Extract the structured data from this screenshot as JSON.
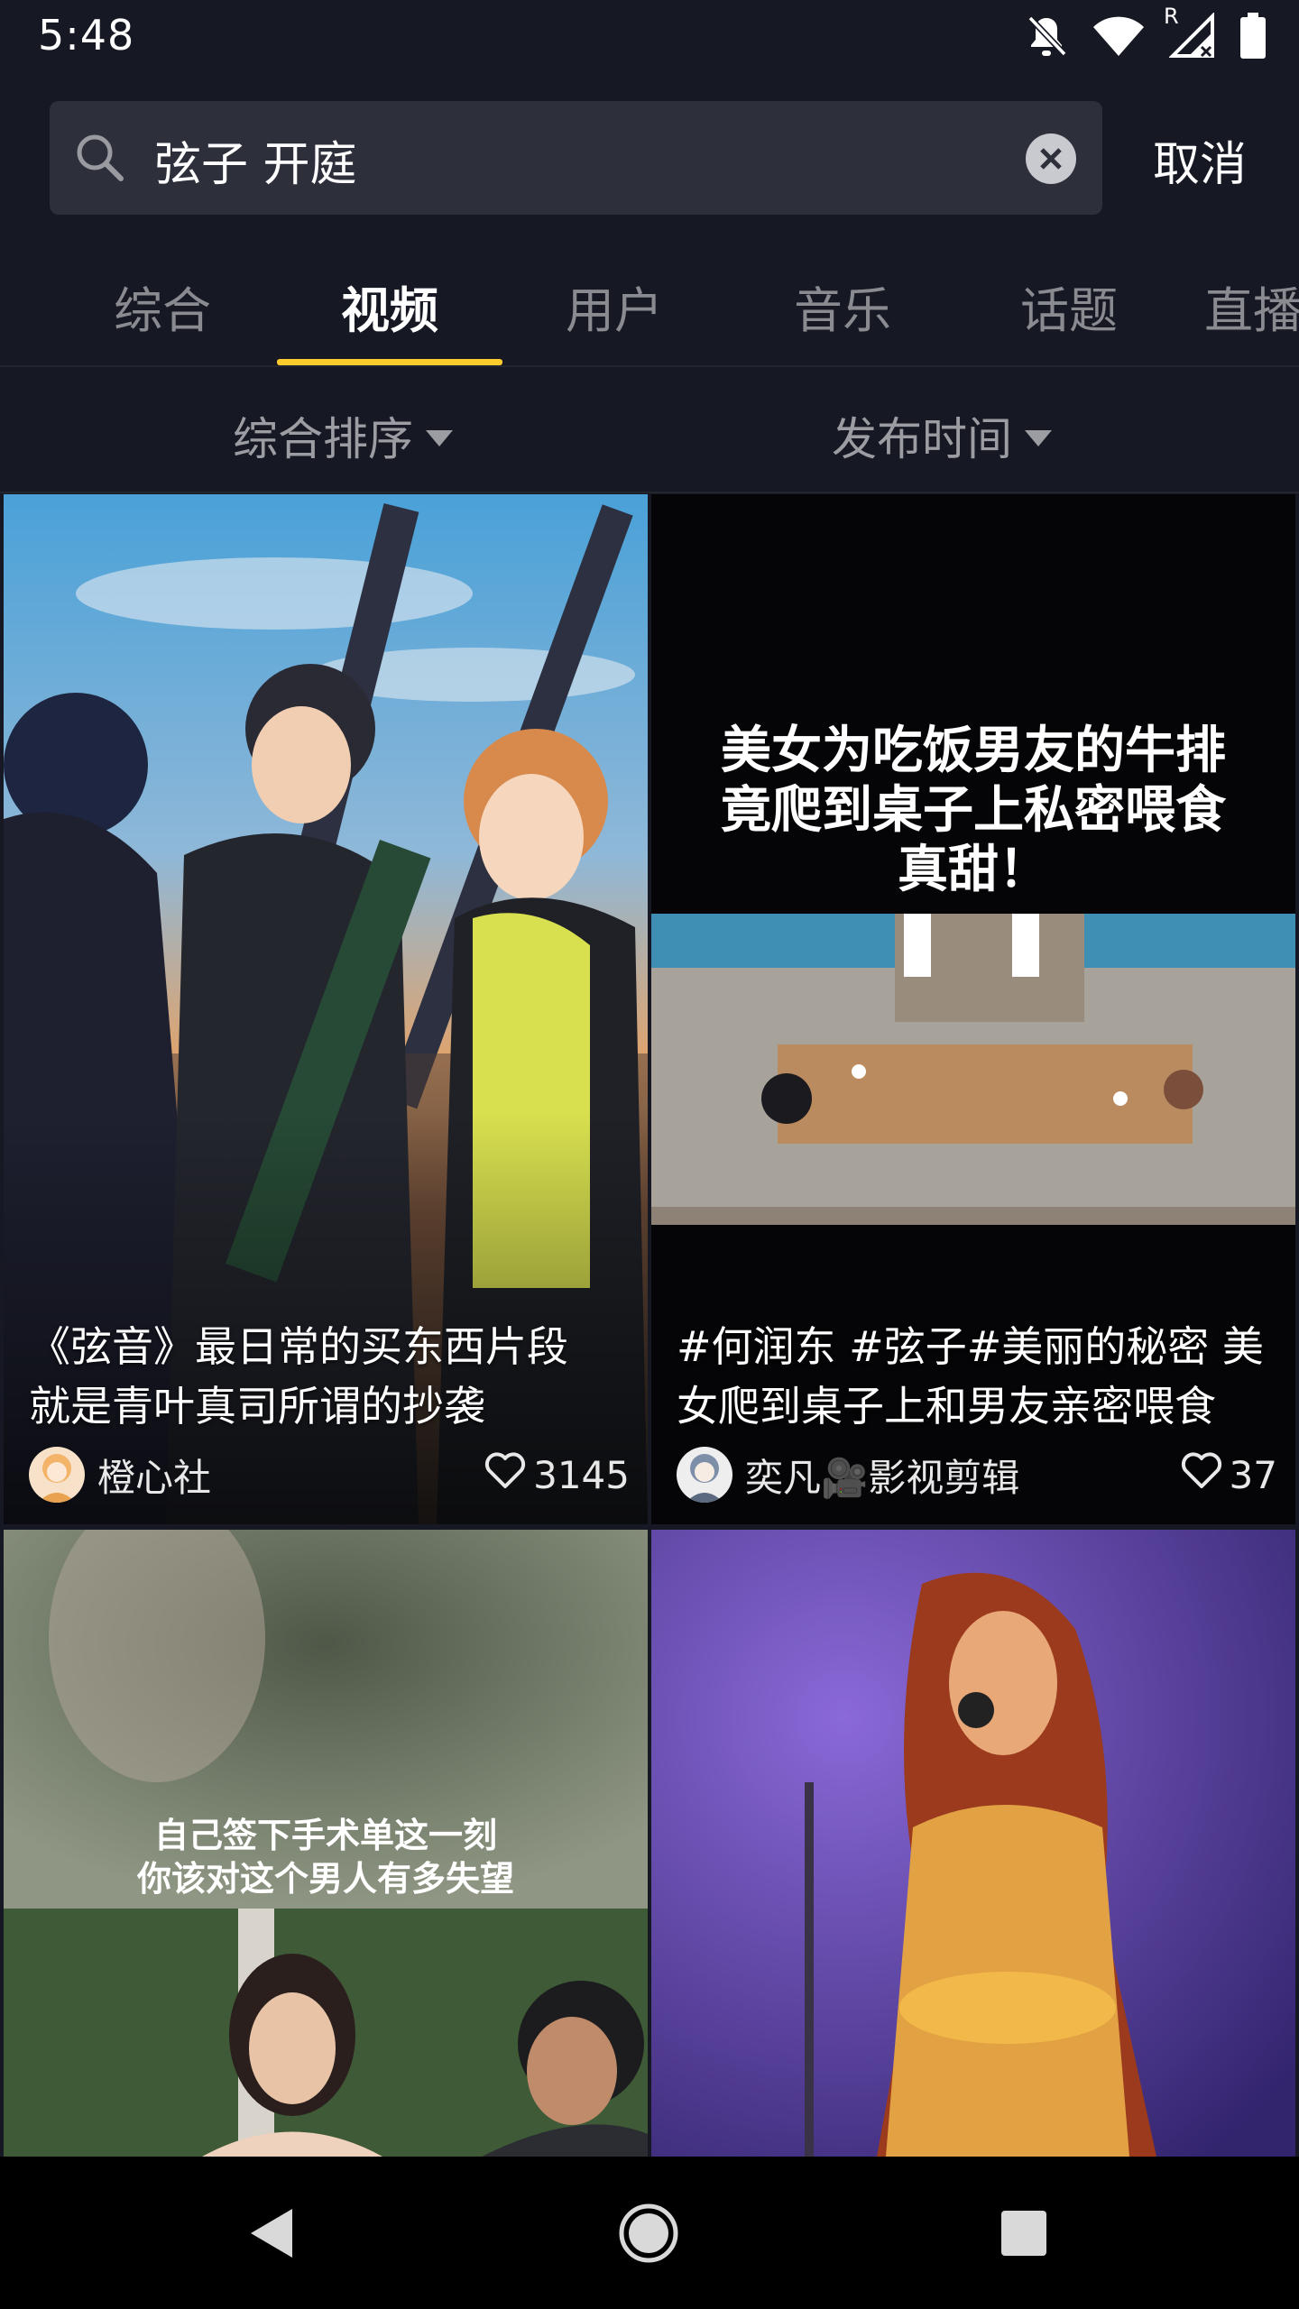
{
  "status_bar": {
    "time": "5:48",
    "icons": [
      "bell-off-icon",
      "wifi-icon",
      "signal-icon",
      "battery-icon"
    ],
    "signal_label": "R"
  },
  "search": {
    "query": "弦子 开庭",
    "cancel_label": "取消"
  },
  "tabs": [
    {
      "label": "综合",
      "active": false
    },
    {
      "label": "视频",
      "active": true
    },
    {
      "label": "用户",
      "active": false
    },
    {
      "label": "音乐",
      "active": false
    },
    {
      "label": "话题",
      "active": false
    },
    {
      "label": "直播",
      "active": false
    }
  ],
  "filters": {
    "sort_label": "综合排序",
    "time_label": "发布时间"
  },
  "cards": [
    {
      "title_line1": "《弦音》最日常的买东西片段",
      "title_line2": "就是青叶真司所谓的抄袭",
      "author": "橙心社",
      "likes": "3145"
    },
    {
      "overlay_line1": "美女为吃饭男友的牛排",
      "overlay_line2": "竟爬到桌子上私密喂食",
      "overlay_line3": "真甜！",
      "title_line1": "#何润东 #弦子#美丽的秘密 美",
      "title_line2": "女爬到桌子上和男友亲密喂食",
      "author": "奕凡🎥影视剪辑",
      "likes": "37"
    },
    {
      "overlay_line1": "自己签下手术单这一刻",
      "overlay_line2": "你该对这个男人有多失望"
    },
    {}
  ],
  "colors": {
    "background": "#161823",
    "accent": "#fdcc2d",
    "inactive_text": "#8a8b91"
  }
}
